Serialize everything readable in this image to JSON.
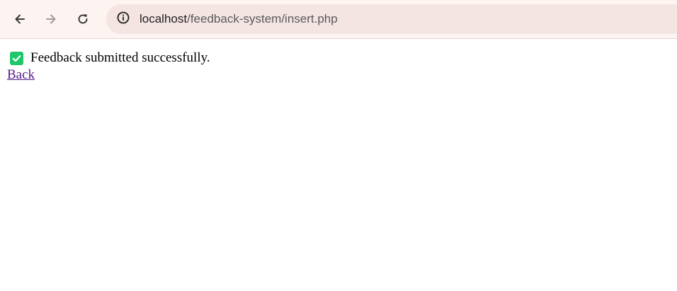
{
  "browser": {
    "url_host": "localhost",
    "url_path": "/feedback-system/insert.php",
    "icons": {
      "back": "arrow-left-icon",
      "forward": "arrow-right-icon",
      "reload": "reload-icon",
      "site_info": "info-icon"
    }
  },
  "page": {
    "message": "Feedback submitted successfully.",
    "status_icon": "check-mark-icon",
    "back_link": "Back"
  },
  "colors": {
    "toolbar_bg": "#fdf3f0",
    "address_bar_bg": "#f4e5e2",
    "success_green": "#1fc76a",
    "visited_link": "#551a8b"
  }
}
